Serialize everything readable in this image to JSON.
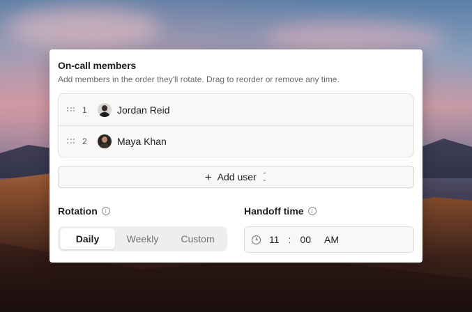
{
  "panel": {
    "title": "On-call members",
    "subtitle": "Add members in the order they'll rotate. Drag to reorder or remove any time."
  },
  "members": [
    {
      "index": "1",
      "name": "Jordan Reid"
    },
    {
      "index": "2",
      "name": "Maya Khan"
    }
  ],
  "add_user": {
    "label": "Add user"
  },
  "rotation": {
    "label": "Rotation",
    "options": [
      "Daily",
      "Weekly",
      "Custom"
    ],
    "selected": "Daily"
  },
  "handoff": {
    "label": "Handoff time",
    "hour": "11",
    "separator": ":",
    "minute": "00",
    "period": "AM"
  },
  "icons": {
    "drag": "drag-handle-icon",
    "plus": "plus-icon",
    "chevrons": "chevron-up-down-icon",
    "info": "info-icon",
    "clock": "clock-icon"
  }
}
